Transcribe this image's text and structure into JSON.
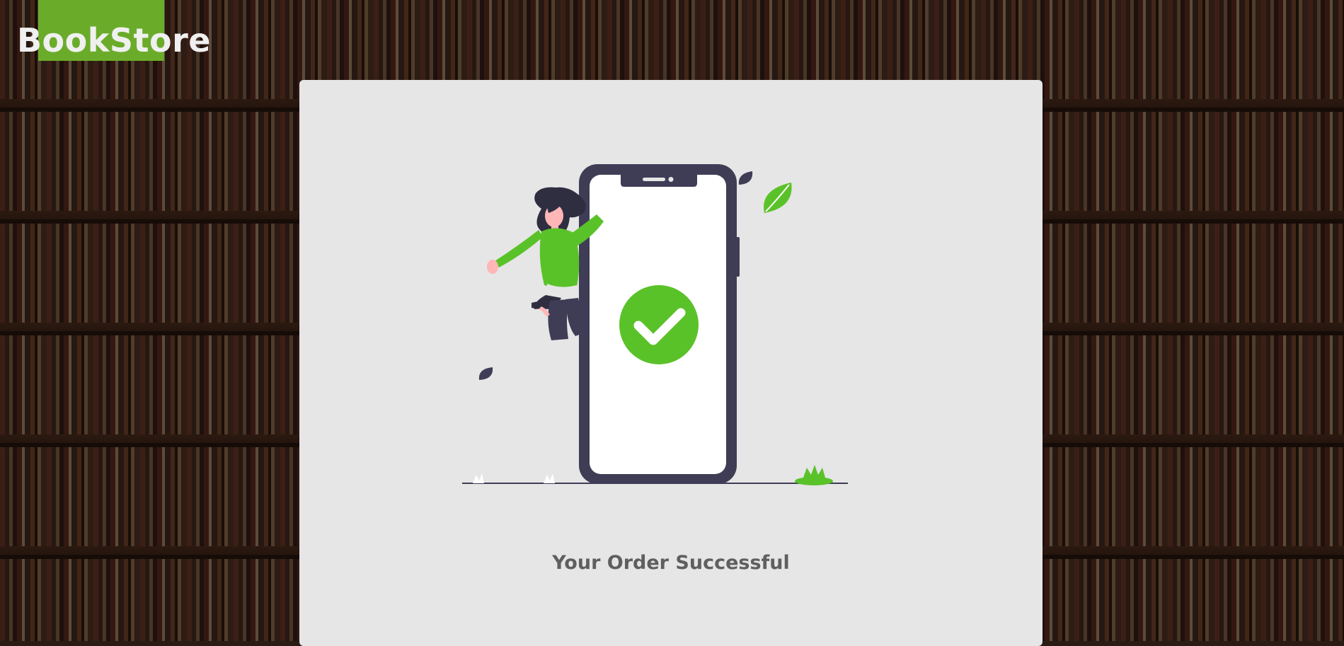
{
  "brand": {
    "name": "BookStore",
    "accent_color": "#6aac2a"
  },
  "order": {
    "message": "Your Order Successful",
    "status_icon": "check-circle-icon",
    "status_color": "#5ac229"
  },
  "illustration": {
    "description_icon": "order-success-illustration"
  }
}
